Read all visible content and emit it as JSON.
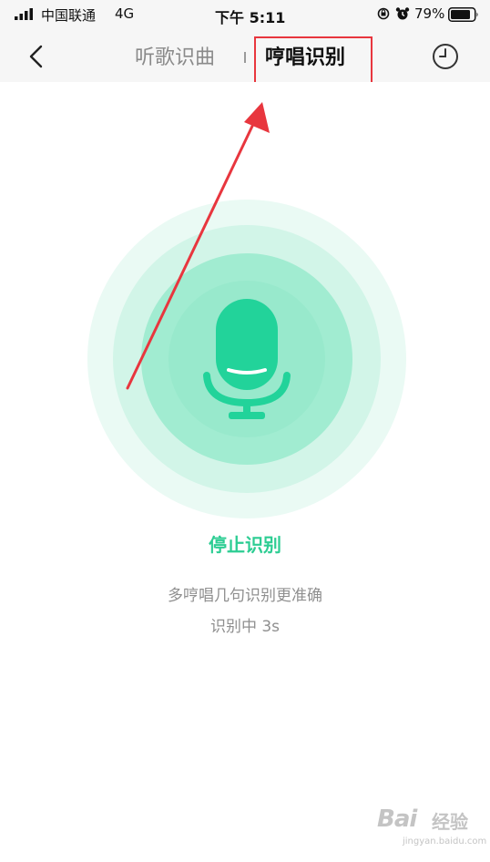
{
  "status_bar": {
    "carrier": "中国联通",
    "network": "4G",
    "time": "下午 5:11",
    "battery": "79%"
  },
  "nav": {
    "tab_listen": "听歌识曲",
    "tab_hum": "哼唱识别"
  },
  "main": {
    "stop_label": "停止识别",
    "hint": "多哼唱几句识别更准确",
    "status": "识别中 3s"
  },
  "watermark": {
    "brand": "Bai",
    "sub": "经验",
    "url": "jingyan.baidu.com"
  },
  "colors": {
    "accent": "#2dcd93",
    "mic": "#22d39a",
    "annotation": "#e8363e",
    "tab_active": "#111111",
    "tab_inactive": "#8a8a8a"
  },
  "icons": {
    "back": "chevron-left-icon",
    "history": "clock-icon",
    "mic": "microphone-icon"
  }
}
